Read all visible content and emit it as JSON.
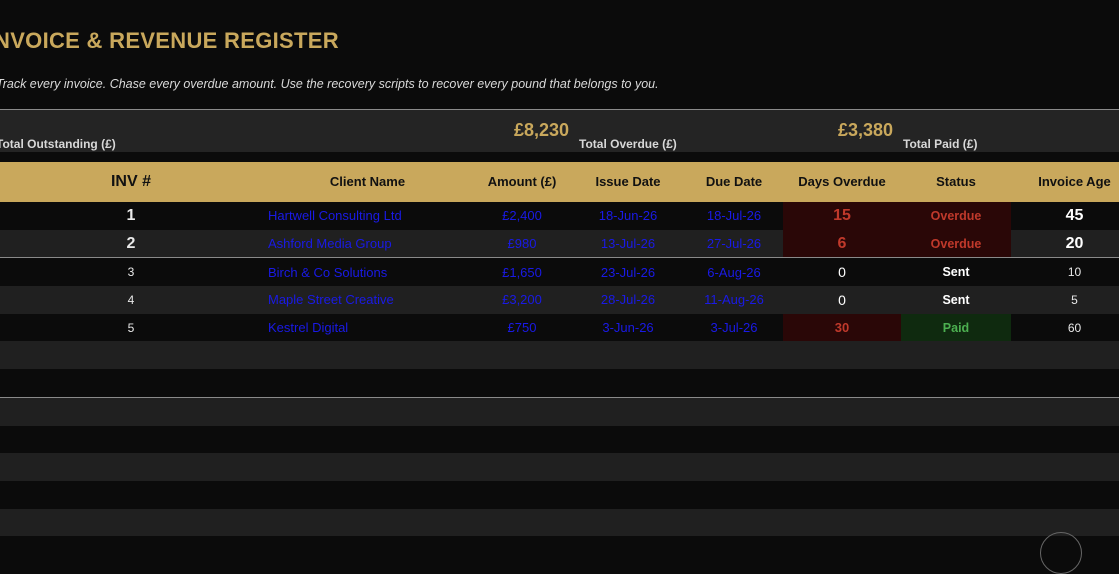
{
  "colors": {
    "accent": "#c9a85c",
    "row_dark": "#0b0b0b",
    "row_alt": "#202020",
    "link": "#1a1ae6",
    "overdue_bg": "#2a0707",
    "overdue_text": "#c0392b",
    "paid_bg": "#0f2a0f",
    "paid_text": "#4caf50"
  },
  "header": {
    "title": "NVOICE & REVENUE REGISTER",
    "subtitle": "Track every invoice. Chase every overdue amount. Use the recovery scripts to recover every pound that belongs to you."
  },
  "summary": {
    "outstanding_label": "Total Outstanding (£)",
    "outstanding_value": "£8,230",
    "overdue_label": "Total Overdue (£)",
    "overdue_value": "£3,380",
    "paid_label": "Total Paid (£)"
  },
  "table": {
    "columns": [
      "INV #",
      "Client Name",
      "Amount (£)",
      "Issue Date",
      "Due Date",
      "Days Overdue",
      "Status",
      "Invoice Age"
    ],
    "rows": [
      {
        "inv": "1",
        "client": "Hartwell Consulting Ltd",
        "amount": "£2,400",
        "issue": "18-Jun-26",
        "due": "18-Jul-26",
        "days": "15",
        "status": "Overdue",
        "age": "45"
      },
      {
        "inv": "2",
        "client": "Ashford Media Group",
        "amount": "£980",
        "issue": "13-Jul-26",
        "due": "27-Jul-26",
        "days": "6",
        "status": "Overdue",
        "age": "20"
      },
      {
        "inv": "3",
        "client": "Birch & Co Solutions",
        "amount": "£1,650",
        "issue": "23-Jul-26",
        "due": "6-Aug-26",
        "days": "0",
        "status": "Sent",
        "age": "10"
      },
      {
        "inv": "4",
        "client": "Maple Street Creative",
        "amount": "£3,200",
        "issue": "28-Jul-26",
        "due": "11-Aug-26",
        "days": "0",
        "status": "Sent",
        "age": "5"
      },
      {
        "inv": "5",
        "client": "Kestrel Digital",
        "amount": "£750",
        "issue": "3-Jun-26",
        "due": "3-Jul-26",
        "days": "30",
        "status": "Paid",
        "age": "60"
      }
    ],
    "empty_rows": 7
  }
}
